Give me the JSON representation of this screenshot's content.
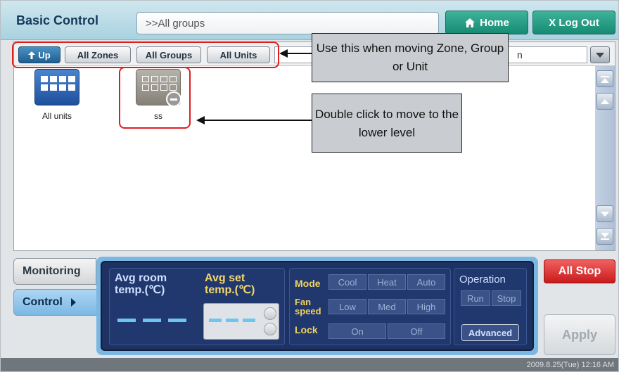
{
  "header": {
    "title": "Basic Control",
    "group_field": ">>All groups",
    "home_label": "Home",
    "logout_label": "X Log Out"
  },
  "toolbar": {
    "up_label": "Up",
    "zones_label": "All Zones",
    "groups_label": "All Groups",
    "units_label": "All Units",
    "select_value_fragment": "n"
  },
  "tiles": [
    {
      "label": "All units",
      "icon": "all-units-icon"
    },
    {
      "label": "ss",
      "icon": "group-icon"
    }
  ],
  "callouts": {
    "toolbar_note": "Use this when moving Zone, Group or Unit",
    "tile_note": "Double click to move to the lower level"
  },
  "tabs": {
    "monitoring": "Monitoring",
    "control": "Control"
  },
  "control": {
    "avg_room_label": "Avg room temp.(℃)",
    "avg_set_label": "Avg set temp.(℃)",
    "mode_label": "Mode",
    "mode_options": [
      "Cool",
      "Heat",
      "Auto"
    ],
    "fan_label": "Fan speed",
    "fan_options": [
      "Low",
      "Med",
      "High"
    ],
    "lock_label": "Lock",
    "lock_options": [
      "On",
      "Off"
    ],
    "operation_label": "Operation",
    "operation_options": [
      "Run",
      "Stop"
    ],
    "advanced_label": "Advanced"
  },
  "actions": {
    "all_stop": "All Stop",
    "apply": "Apply"
  },
  "status": {
    "datetime": "2009.8.25(Tue)  12:16 AM"
  },
  "colors": {
    "highlight": "#e01e1e",
    "panel": "#1d3262",
    "accent": "#168a72"
  }
}
